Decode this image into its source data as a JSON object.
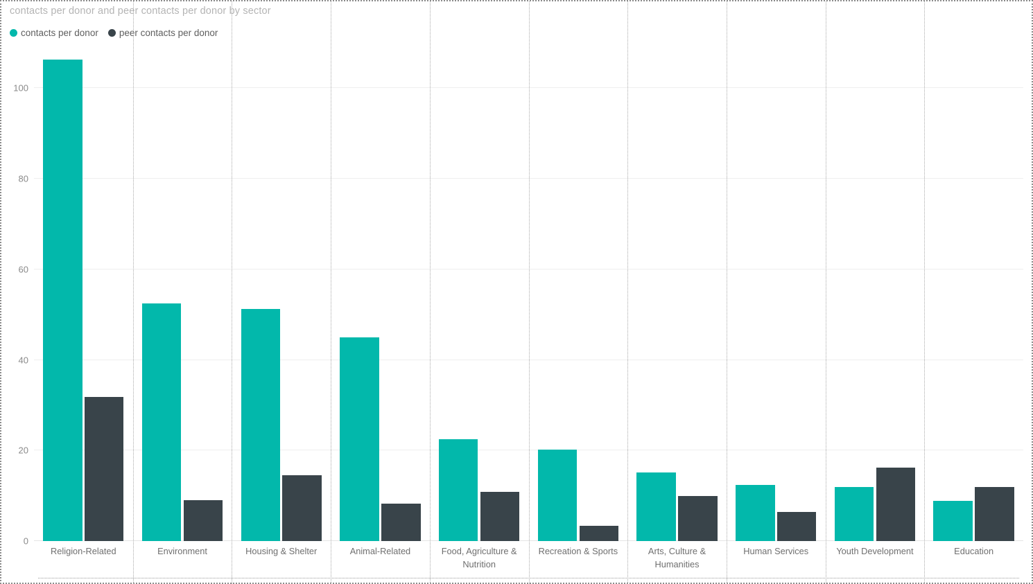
{
  "chart_data": {
    "type": "bar",
    "title": "contacts per donor and peer contacts per donor by sector",
    "xlabel": "",
    "ylabel": "",
    "ylim": [
      0,
      110
    ],
    "yticks": [
      0,
      20,
      40,
      60,
      80,
      100
    ],
    "ytick_labels": [
      "0",
      "20",
      "40",
      "60",
      "80",
      "100"
    ],
    "grid": true,
    "legend_position": "top-left",
    "categories": [
      "Religion-Related",
      "Environment",
      "Housing & Shelter",
      "Animal-Related",
      "Food, Agriculture & Nutrition",
      "Recreation & Sports",
      "Arts, Culture & Humanities",
      "Human Services",
      "Youth Development",
      "Education"
    ],
    "series": [
      {
        "name": "contacts per donor",
        "color": "#02b8ab",
        "values": [
          106.4,
          52.5,
          51.3,
          45.0,
          22.5,
          20.2,
          15.2,
          12.4,
          11.9,
          8.8
        ]
      },
      {
        "name": "peer contacts per donor",
        "color": "#39444a",
        "values": [
          31.9,
          9.1,
          14.5,
          8.2,
          10.8,
          3.4,
          10.0,
          6.4,
          16.2,
          12.0
        ]
      }
    ]
  },
  "legend": {
    "items": [
      {
        "label": "contacts per donor",
        "color": "#02b8ab"
      },
      {
        "label": "peer contacts per donor",
        "color": "#39444a"
      }
    ]
  }
}
